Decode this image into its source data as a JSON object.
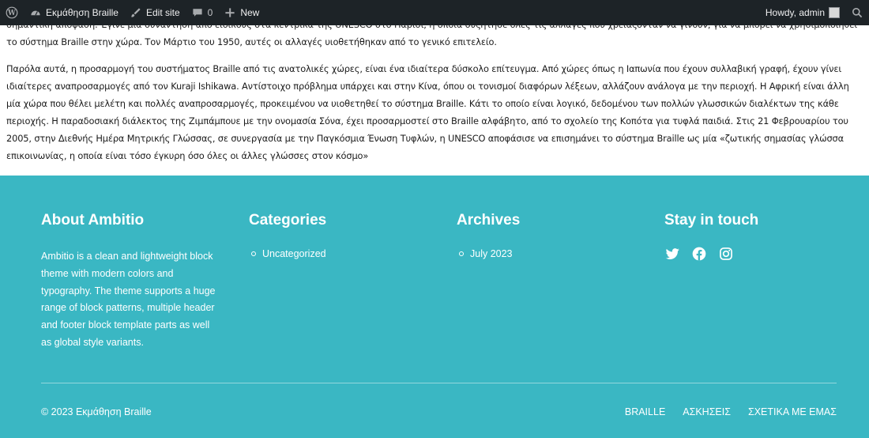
{
  "admin_bar": {
    "site_name": "Εκμάθηση Braille",
    "edit_site": "Edit site",
    "comments_count": "0",
    "new_label": "New",
    "howdy": "Howdy, admin"
  },
  "article": {
    "paragraphs": [
      "σημαντική απόφαση. Έγινε μία συνάντηση από ειδικούς στα κεντρικά της UNESCO στο Παρίσι, η οποία συζήτησε όλες τις αλλαγές που χρειάζονταν να γίνουν, για να μπορεί να χρησιμοποιηθεί το σύστημα Braille στην χώρα. Τον Μάρτιο του 1950, αυτές οι αλλαγές υιοθετήθηκαν από το γενικό επιτελείο.",
      "Παρόλα αυτά, η προσαρμογή του συστήματος Braille από τις ανατολικές χώρες, είναι ένα ιδιαίτερα δύσκολο επίτευγμα. Από χώρες όπως η Ιαπωνία που έχουν συλλαβική γραφή, έχουν γίνει ιδιαίτερες αναπροσαρμογές από τον Kuraji Ishikawa. Αντίστοιχο πρόβλημα υπάρχει και στην Κίνα, όπου οι τονισμοί διαφόρων λέξεων, αλλάζουν ανάλογα με την περιοχή. Η Αφρική είναι άλλη μία χώρα που θέλει μελέτη και πολλές αναπροσαρμογές, προκειμένου να υιοθετηθεί το σύστημα Braille. Κάτι το οποίο είναι λογικό, δεδομένου των πολλών γλωσσικών διαλέκτων της κάθε περιοχής. Η παραδοσιακή διάλεκτος της Ζιμπάμπουε με την ονομασία Σόνα, έχει προσαρμοστεί στο Braille αλφάβητο, από το σχολείο της Κοπότα για τυφλά παιδιά. Στις 21 Φεβρουαρίου του 2005, στην Διεθνής Ημέρα Μητρικής Γλώσσας, σε συνεργασία με την Παγκόσμια Ένωση Τυφλών, η UNESCO αποφάσισε να επισημάνει το σύστημα Braille ως μία «ζωτικής σημασίας γλώσσα επικοινωνίας, η οποία είναι τόσο έγκυρη όσο όλες οι άλλες γλώσσες στον κόσμο»"
    ]
  },
  "footer": {
    "about": {
      "title": "About Ambitio",
      "text": "Ambitio is a clean and lightweight block theme with modern colors and typography. The theme supports a huge range of block patterns, multiple header and footer block template parts as well as global style variants."
    },
    "categories": {
      "title": "Categories",
      "items": [
        "Uncategorized"
      ]
    },
    "archives": {
      "title": "Archives",
      "items": [
        "July 2023"
      ]
    },
    "stay": {
      "title": "Stay in touch",
      "icons": [
        "twitter-icon",
        "facebook-icon",
        "instagram-icon"
      ]
    },
    "copyright": "© 2023 Εκμάθηση Braille",
    "nav": [
      "BRAILLE",
      "ΑΣΚΗΣΕΙΣ",
      "ΣΧΕΤΙΚΑ ΜΕ ΕΜΑΣ"
    ]
  },
  "colors": {
    "admin_bar_bg": "#1d2327",
    "footer_bg": "#3ab7c3"
  }
}
